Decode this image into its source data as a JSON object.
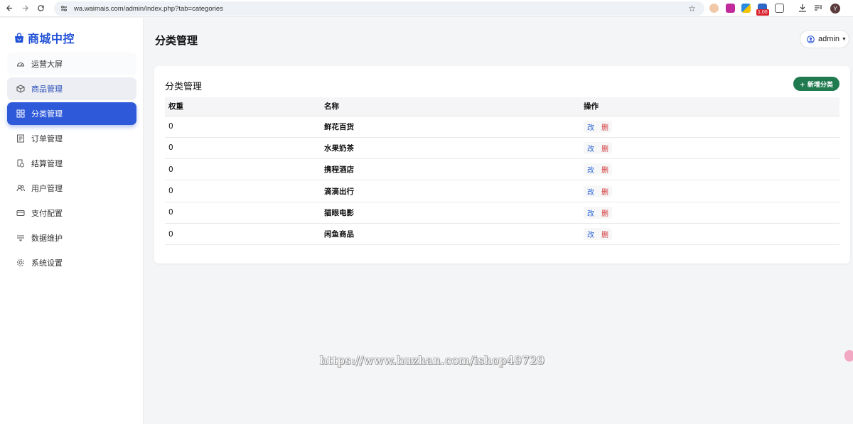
{
  "browser": {
    "url": "wa.waimais.com/admin/index.php?tab=categories",
    "extension_badge": "1.00",
    "profile_initial": "Y"
  },
  "sidebar": {
    "brand": "商城中控",
    "items": [
      {
        "label": "运营大屏",
        "icon": "dashboard-icon"
      },
      {
        "label": "商品管理",
        "icon": "box-icon"
      },
      {
        "label": "分类管理",
        "icon": "grid-icon"
      },
      {
        "label": "订单管理",
        "icon": "list-icon"
      },
      {
        "label": "结算管理",
        "icon": "settlement-icon"
      },
      {
        "label": "用户管理",
        "icon": "users-icon"
      },
      {
        "label": "支付配置",
        "icon": "card-icon"
      },
      {
        "label": "数据维护",
        "icon": "tools-icon"
      },
      {
        "label": "系统设置",
        "icon": "gear-icon"
      }
    ]
  },
  "header": {
    "title": "分类管理",
    "user": "admin"
  },
  "card": {
    "title": "分类管理",
    "add_button": "+ 新增分类",
    "columns": [
      "权重",
      "名称",
      "操作"
    ],
    "rows": [
      {
        "weight": "0",
        "name": "鲜花百货"
      },
      {
        "weight": "0",
        "name": "水果奶茶"
      },
      {
        "weight": "0",
        "name": "携程酒店"
      },
      {
        "weight": "0",
        "name": "滴滴出行"
      },
      {
        "weight": "0",
        "name": "猫眼电影"
      },
      {
        "weight": "0",
        "name": "闲鱼商品"
      }
    ],
    "edit_label": "改",
    "delete_label": "删"
  },
  "watermark": "https://www.huzhan.com/ishop49729",
  "colors": {
    "accent": "#2e59d9",
    "brand": "#2151d6",
    "add_button": "#1f7a4f",
    "delete": "#d33a3a",
    "edit": "#2a66d6"
  }
}
